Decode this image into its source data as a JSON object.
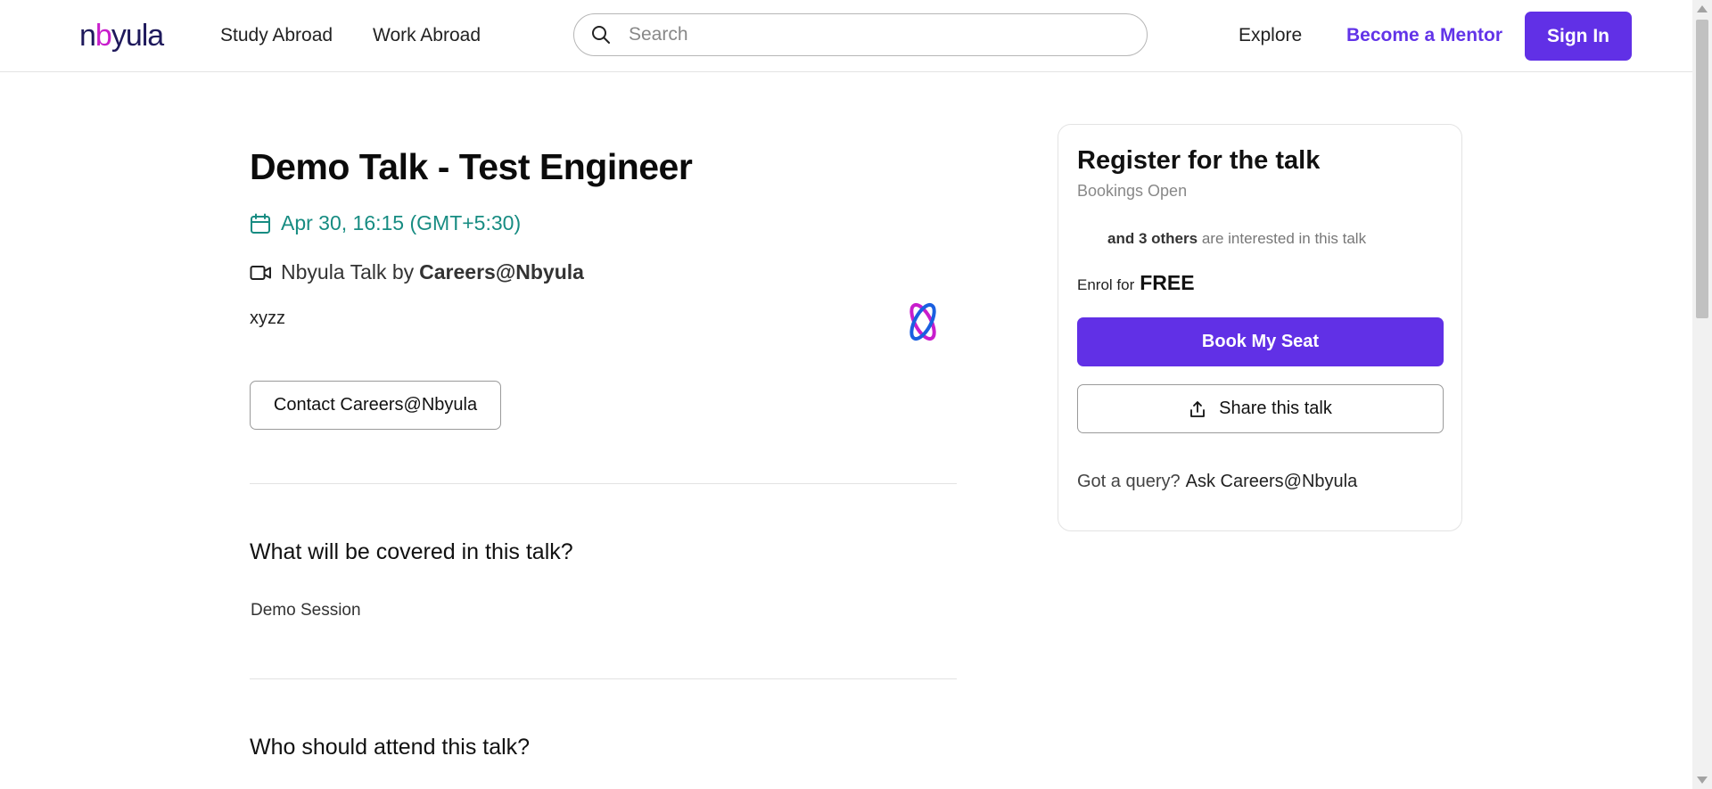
{
  "header": {
    "logo": {
      "part1": "n",
      "part2": "b",
      "part3": "yula",
      "alt": "nbyula"
    },
    "nav": [
      "Study Abroad",
      "Work Abroad"
    ],
    "search": {
      "placeholder": "Search",
      "value": ""
    },
    "explore": "Explore",
    "become_mentor": "Become a Mentor",
    "sign_in": "Sign In"
  },
  "talk": {
    "title": "Demo Talk - Test Engineer",
    "date": "Apr 30, 16:15 (GMT+5:30)",
    "host_prefix": "Nbyula Talk by",
    "host_name": "Careers@Nbyula",
    "description": "xyzz",
    "contact_label": "Contact Careers@Nbyula"
  },
  "sections": [
    {
      "heading": "What will be covered in this talk?",
      "body": "Demo Session"
    },
    {
      "heading": "Who should attend this talk?"
    }
  ],
  "register": {
    "title": "Register for the talk",
    "status": "Bookings Open",
    "interest_bold": "and 3 others",
    "interest_rest": "are interested in this talk",
    "enrol_prefix": "Enrol for",
    "price": "FREE",
    "book_label": "Book My Seat",
    "share_label": "Share this talk",
    "query_prefix": "Got a query?",
    "query_link": "Ask Careers@Nbyula"
  },
  "colors": {
    "brand": "#6130e6",
    "date_accent": "#178c82",
    "logo_magenta": "#c81ecc",
    "logo_blue": "#1a5fe0"
  },
  "icons": [
    "search-icon",
    "calendar-icon",
    "video-camera-icon",
    "nbyula-mark-icon",
    "share-upload-icon"
  ]
}
